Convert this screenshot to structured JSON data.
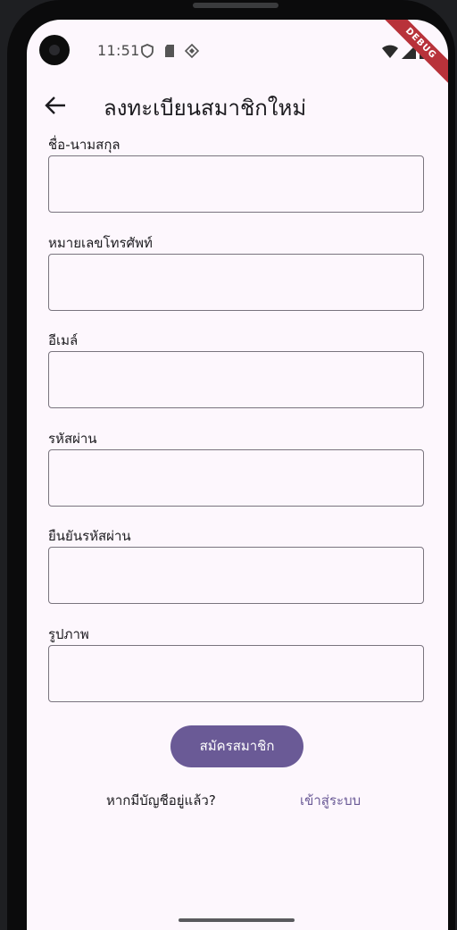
{
  "status_bar": {
    "time": "11:51",
    "debug_label": "DEBUG"
  },
  "appbar": {
    "title": "ลงทะเบียนสมาชิกใหม่",
    "back_icon": "arrow-back-icon"
  },
  "form": {
    "fields": [
      {
        "label": "ชื่อ-นามสกุล",
        "value": ""
      },
      {
        "label": "หมายเลขโทรศัพท์",
        "value": ""
      },
      {
        "label": "อีเมล์",
        "value": ""
      },
      {
        "label": "รหัสผ่าน",
        "value": ""
      },
      {
        "label": "ยืนยันรหัสผ่าน",
        "value": ""
      },
      {
        "label": "รูปภาพ",
        "value": ""
      }
    ],
    "submit_label": "สมัครสมาชิก",
    "have_account_text": "หากมีบัญชีอยู่แล้ว?",
    "login_link": "เข้าสู่ระบบ"
  },
  "colors": {
    "primary": "#6a5a96",
    "background": "#fdf7fd",
    "outline": "#79747e"
  }
}
